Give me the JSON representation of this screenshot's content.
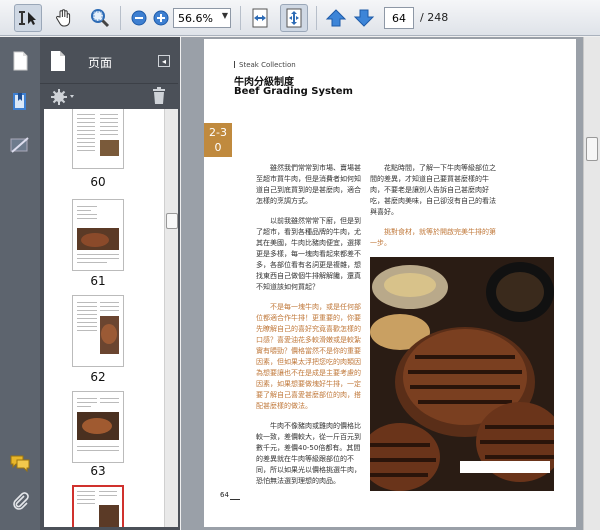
{
  "toolbar": {
    "zoom_value": "56.6%",
    "page_current": "64",
    "page_total": "/ 248"
  },
  "panel": {
    "title": "页面",
    "close_label": "◂"
  },
  "thumbnails": [
    {
      "label": "60"
    },
    {
      "label": "61"
    },
    {
      "label": "62"
    },
    {
      "label": "63"
    }
  ],
  "document": {
    "series": "Steak  Collection",
    "title_zh": "牛肉分級制度",
    "title_en": "Beef Grading System",
    "badge_line1": "2-3",
    "badge_line2": "0",
    "left_col": [
      "雖然我們常常到市場、賣場甚至超市買牛肉，但是消費者如何知道自己到底買到的是甚麼肉，適合怎樣的烹調方式。",
      "以前我雖然常常下廚，但是到了超市，看到各種品牌的牛肉，尤其在美國，牛肉比豬肉便宜，選擇更是多樣，每一塊肉看起來都差不多，各部位看有名詞更是複雜，想找東西自己做個牛排解解饞，還真不知道該如何買起？",
      "不是每一塊牛肉，或是任何部位都適合作牛排！更重要的，你要先瞭解自己的喜好究竟喜歡怎樣的口感？喜愛油花多較滑嫩或是較紮實有嚼勁？價格當然不是你的重要因素，但如果太浮把您吃的肉類因為想要讓也不在是成是主要考慮的因素，如果想要做塊好牛排，一定要了解自己喜愛甚麼部位的肉，搭配甚麼樣的做法。",
      "牛肉不像豬肉或雞肉的價格比較一致，差價較大，從一斤百元到數千元，差價40-50倍都有。其間的差異就在牛肉等級跟部位的不同，所以如果光以價格挑選牛肉，恐怕無法選到理想的肉品。"
    ],
    "right_col": [
      "花點時間，了解一下牛肉等級部位之間的差異，才知道自己要買甚麼樣的牛肉，不要老是讓別人告訴自己甚麼肉好吃，甚麼肉美味，自己卻沒有自己的看法與喜好。",
      "挑對食材，就等於開啟完美牛排的第一步。"
    ],
    "page_number": "64"
  }
}
